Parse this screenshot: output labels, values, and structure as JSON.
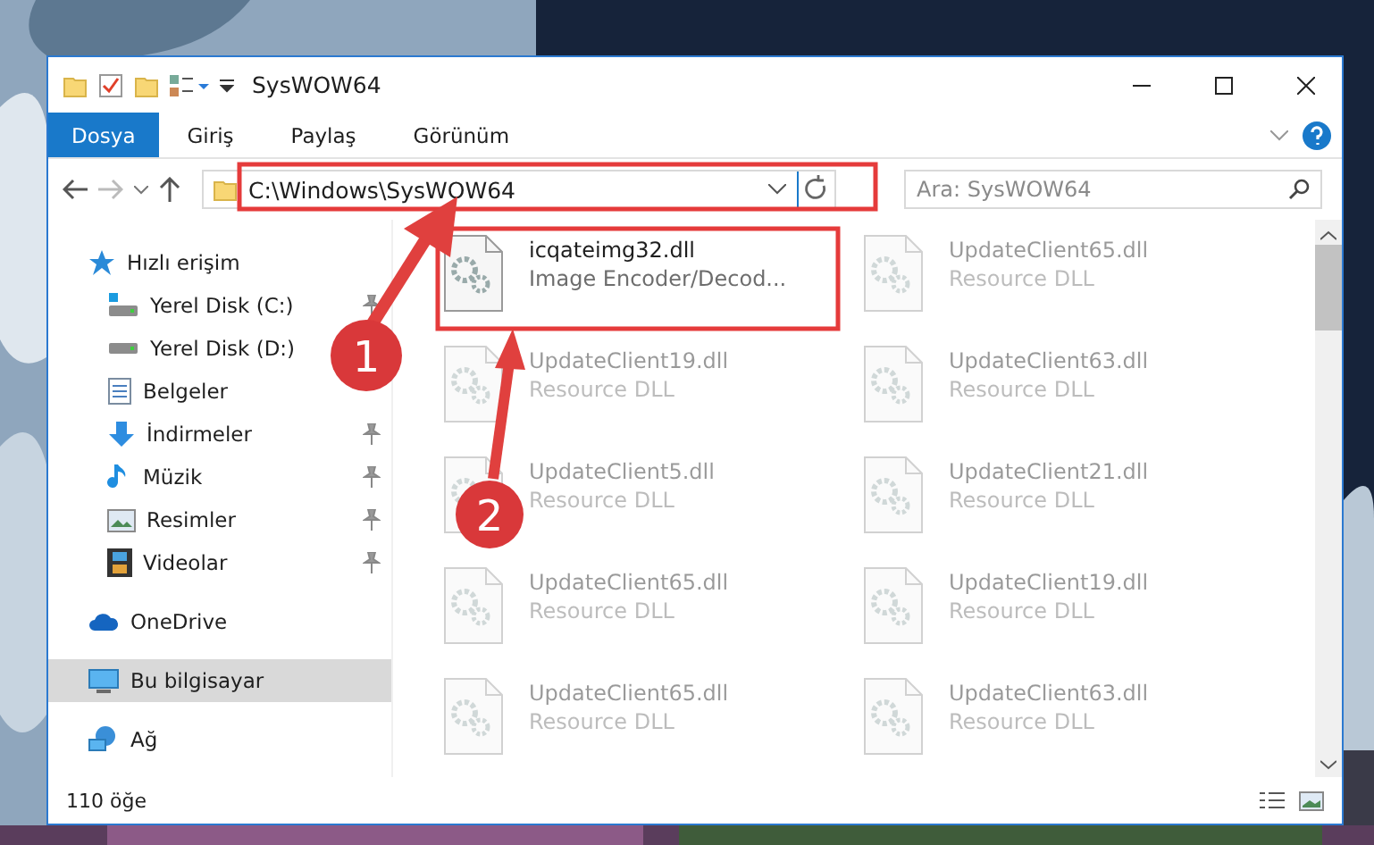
{
  "window": {
    "title": "SysWOW64"
  },
  "ribbon_tabs": [
    {
      "label": "Dosya",
      "selected": true
    },
    {
      "label": "Giriş",
      "selected": false
    },
    {
      "label": "Paylaş",
      "selected": false
    },
    {
      "label": "Görünüm",
      "selected": false
    }
  ],
  "address": {
    "path": "C:\\Windows\\SysWOW64"
  },
  "search": {
    "placeholder": "Ara: SysWOW64"
  },
  "nav": [
    {
      "label": "Hızlı erişim",
      "kind": "quick",
      "selected": false,
      "children": [
        {
          "label": "Yerel Disk (C:)",
          "kind": "diskc",
          "pinned": true
        },
        {
          "label": "Yerel Disk (D:)",
          "kind": "disk",
          "pinned": false
        },
        {
          "label": "Belgeler",
          "kind": "docs",
          "pinned": false
        },
        {
          "label": "İndirmeler",
          "kind": "download",
          "pinned": true
        },
        {
          "label": "Müzik",
          "kind": "music",
          "pinned": true
        },
        {
          "label": "Resimler",
          "kind": "pictures",
          "pinned": true
        },
        {
          "label": "Videolar",
          "kind": "videos",
          "pinned": true
        }
      ]
    },
    {
      "label": "OneDrive",
      "kind": "cloud",
      "selected": false
    },
    {
      "label": "Bu bilgisayar",
      "kind": "pc",
      "selected": true
    },
    {
      "label": "Ağ",
      "kind": "network",
      "selected": false
    }
  ],
  "files": [
    {
      "name": "icqateimg32.dll",
      "description": "Image Encoder/Decod...",
      "blurred": false
    },
    {
      "name": "UpdateClient65.dll",
      "description": "Resource DLL",
      "blurred": true
    },
    {
      "name": "UpdateClient19.dll",
      "description": "Resource DLL",
      "blurred": true
    },
    {
      "name": "UpdateClient63.dll",
      "description": "Resource DLL",
      "blurred": true
    },
    {
      "name": "UpdateClient5.dll",
      "description": "Resource DLL",
      "blurred": true
    },
    {
      "name": "UpdateClient21.dll",
      "description": "Resource DLL",
      "blurred": true
    },
    {
      "name": "UpdateClient65.dll",
      "description": "Resource DLL",
      "blurred": true
    },
    {
      "name": "UpdateClient19.dll",
      "description": "Resource DLL",
      "blurred": true
    },
    {
      "name": "UpdateClient65.dll",
      "description": "Resource DLL",
      "blurred": true
    },
    {
      "name": "UpdateClient63.dll",
      "description": "Resource DLL",
      "blurred": true
    }
  ],
  "status_bar": {
    "count": "110 öğe"
  },
  "annotations": [
    {
      "number": "1"
    },
    {
      "number": "2"
    }
  ]
}
